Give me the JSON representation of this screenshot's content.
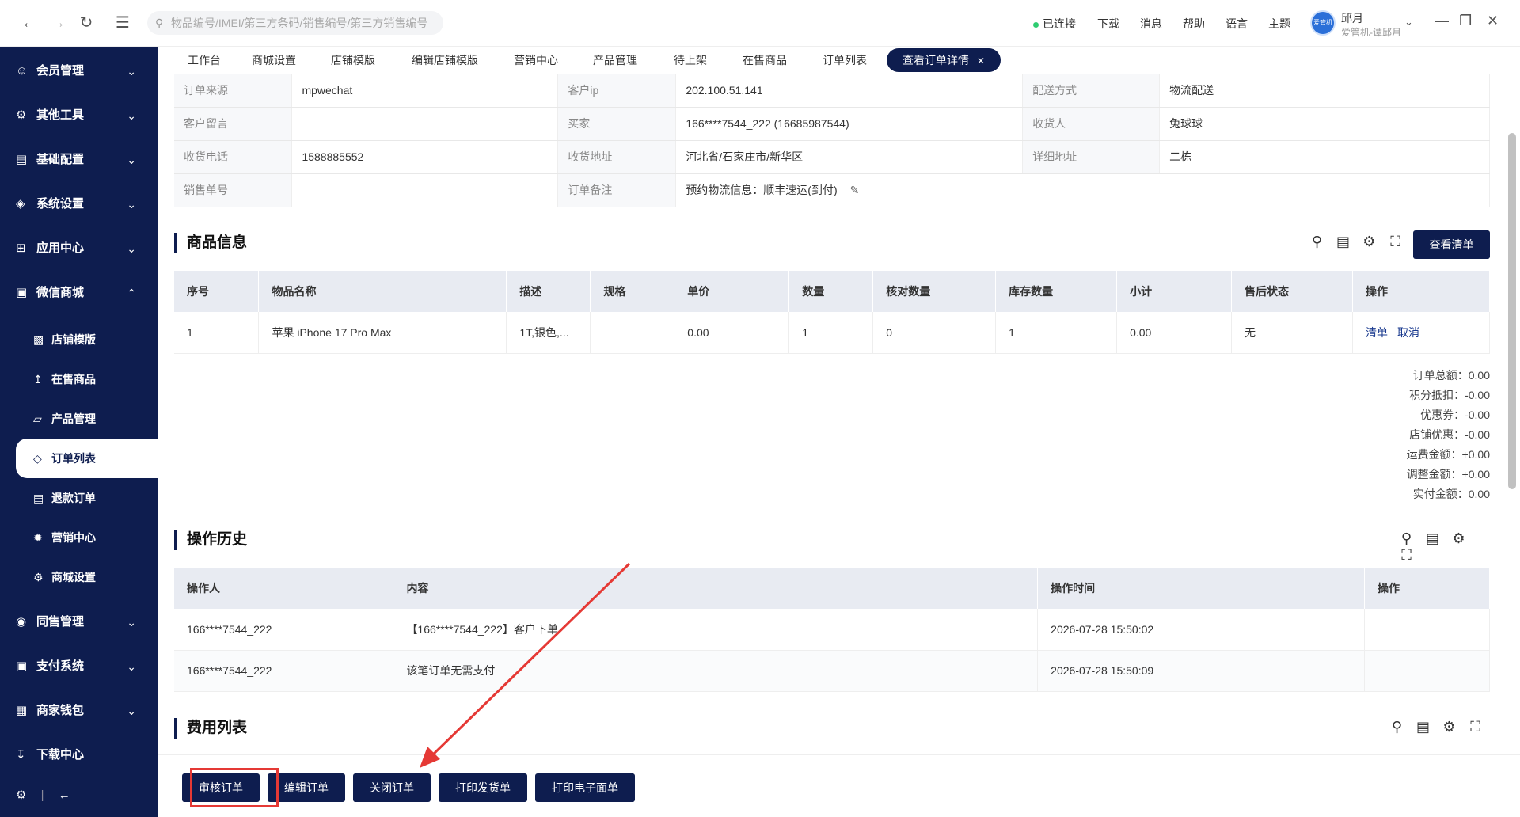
{
  "topbar": {
    "search_placeholder": "物品编号/IMEI/第三方条码/销售编号/第三方销售编号",
    "status": "已连接",
    "download": "下载",
    "messages": "消息",
    "help": "帮助",
    "language": "语言",
    "theme": "主题",
    "user_name": "邱月",
    "user_sub": "爱管机-谭邱月",
    "avatar_text": "爱管机"
  },
  "sidebar": {
    "items": [
      {
        "label": "会员管理"
      },
      {
        "label": "其他工具"
      },
      {
        "label": "基础配置"
      },
      {
        "label": "系统设置"
      },
      {
        "label": "应用中心"
      },
      {
        "label": "微信商城"
      }
    ],
    "subitems": [
      {
        "label": "店铺模版"
      },
      {
        "label": "在售商品"
      },
      {
        "label": "产品管理"
      },
      {
        "label": "订单列表"
      },
      {
        "label": "退款订单"
      },
      {
        "label": "营销中心"
      },
      {
        "label": "商城设置"
      }
    ],
    "bottom_items": [
      {
        "label": "同售管理"
      },
      {
        "label": "支付系统"
      },
      {
        "label": "商家钱包"
      },
      {
        "label": "下载中心"
      }
    ]
  },
  "tabs": [
    "工作台",
    "商城设置",
    "店铺模版",
    "编辑店铺模版",
    "营销中心",
    "产品管理",
    "待上架",
    "在售商品",
    "订单列表",
    "查看订单详情"
  ],
  "order_info": {
    "rows": [
      [
        "订单来源",
        "mpwechat",
        "客户ip",
        "202.100.51.141",
        "配送方式",
        "物流配送"
      ],
      [
        "客户留言",
        "",
        "买家",
        "166****7544_222 (16685987544)",
        "收货人",
        "兔球球"
      ],
      [
        "收货电话",
        "1588885552",
        "收货地址",
        "河北省/石家庄市/新华区",
        "详细地址",
        "二栋"
      ],
      [
        "销售单号",
        "",
        "订单备注",
        "预约物流信息：顺丰速运(到付)",
        "",
        ""
      ]
    ]
  },
  "goods": {
    "title": "商品信息",
    "view_list_btn": "查看清单",
    "headers": [
      "序号",
      "物品名称",
      "描述",
      "规格",
      "单价",
      "数量",
      "核对数量",
      "库存数量",
      "小计",
      "售后状态",
      "操作"
    ],
    "rows": [
      {
        "no": "1",
        "name": "苹果 iPhone 17 Pro Max",
        "desc": "1T,银色,...",
        "spec": "",
        "price": "0.00",
        "qty": "1",
        "checked": "0",
        "stock": "1",
        "subtotal": "0.00",
        "after_sale": "无",
        "op1": "清单",
        "op2": "取消"
      }
    ]
  },
  "summary": [
    "订单总额：0.00",
    "积分抵扣：-0.00",
    "优惠券：-0.00",
    "店铺优惠：-0.00",
    "运费金额：+0.00",
    "调整金额：+0.00",
    "实付金额：0.00"
  ],
  "history": {
    "title": "操作历史",
    "headers": [
      "操作人",
      "内容",
      "操作时间",
      "操作"
    ],
    "rows": [
      {
        "operator": "166****7544_222",
        "content": "【166****7544_222】客户下单",
        "time": "2026-07-28 15:50:02",
        "op": ""
      },
      {
        "operator": "166****7544_222",
        "content": "该笔订单无需支付",
        "time": "2026-07-28 15:50:09",
        "op": ""
      }
    ]
  },
  "fees": {
    "title": "费用列表"
  },
  "bottom_buttons": [
    "审核订单",
    "编辑订单",
    "关闭订单",
    "打印发货单",
    "打印电子面单"
  ],
  "colors": {
    "primary": "#0e1d4f",
    "highlight": "#e53935",
    "connected": "#2ecc71"
  }
}
